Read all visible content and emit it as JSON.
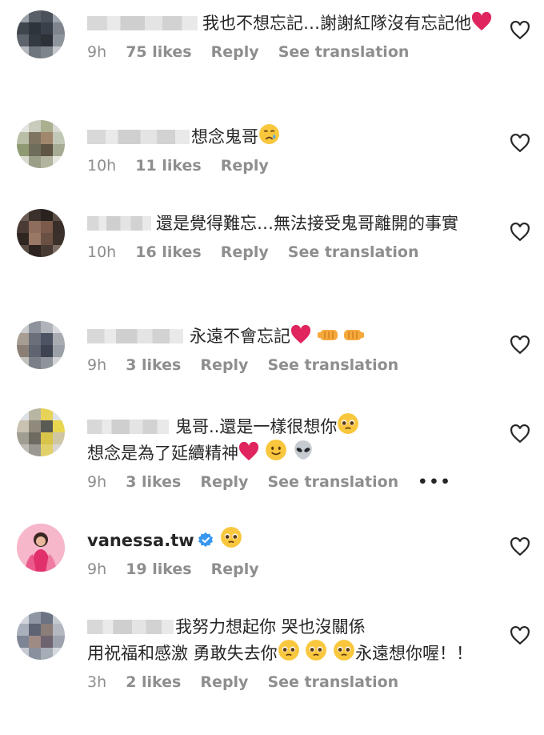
{
  "comments": [
    {
      "user": "",
      "text": "我也不想忘記…謝謝紅隊沒有忘記他",
      "emojis": [
        "red-heart"
      ],
      "time": "9h",
      "likes": "75 likes",
      "reply": "Reply",
      "translation": "See translation"
    },
    {
      "user": "",
      "text": "想念鬼哥",
      "emojis": [
        "crying-face"
      ],
      "time": "10h",
      "likes": "11 likes",
      "reply": "Reply",
      "translation": ""
    },
    {
      "user": "",
      "text": "還是覺得難忘…無法接受鬼哥離開的事實",
      "emojis": [],
      "time": "10h",
      "likes": "16 likes",
      "reply": "Reply",
      "translation": "See translation"
    },
    {
      "user": "",
      "text": "永遠不會忘記",
      "emojis": [
        "red-heart",
        "left-fist",
        "right-fist"
      ],
      "time": "9h",
      "likes": "3 likes",
      "reply": "Reply",
      "translation": "See translation"
    },
    {
      "user": "",
      "text": "鬼哥..還是一樣很想你",
      "text2": "想念是為了延續精神",
      "emojis": [
        "pleading-face"
      ],
      "emojis2": [
        "red-heart",
        "smiling-face",
        "alien"
      ],
      "time": "9h",
      "likes": "3 likes",
      "reply": "Reply",
      "translation": "See translation",
      "more": "•••"
    },
    {
      "user": "vanessa.tw",
      "verified": true,
      "text": "",
      "emojis": [
        "pleading-face"
      ],
      "time": "9h",
      "likes": "19 likes",
      "reply": "Reply",
      "translation": ""
    },
    {
      "user": "",
      "text": "我努力想起你 哭也沒關係",
      "text2": "用祝福和感激 勇敢失去你",
      "text3": "永遠想你喔！！",
      "emojis": [],
      "emojis2": [
        "pleading-face",
        "pleading-face",
        "pleading-face"
      ],
      "time": "3h",
      "likes": "2 likes",
      "reply": "Reply",
      "translation": "See translation"
    }
  ],
  "colors": {
    "text": "#262626",
    "meta": "#8e8e8e",
    "verified": "#3897f0",
    "heart": "#e0245e"
  }
}
